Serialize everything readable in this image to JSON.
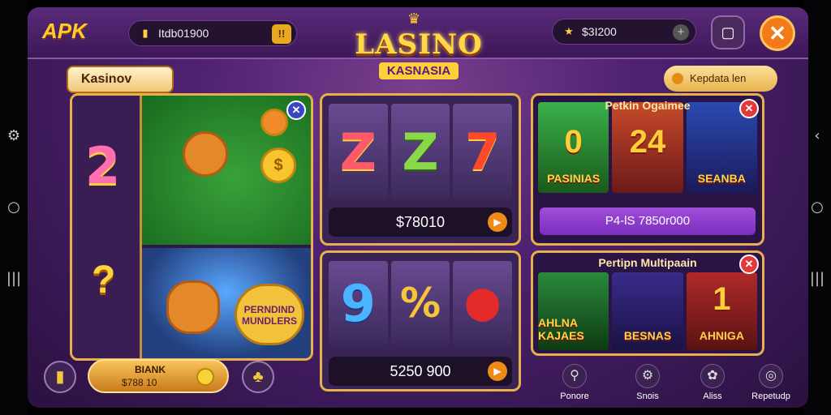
{
  "topbar": {
    "brand": "APK",
    "balance1": "Itdb01900",
    "balance2": "$3I200",
    "logo_line1": "LASINO",
    "logo_line2": "KASNASIA"
  },
  "tabs": {
    "left": "Kasinov",
    "right": "Kepdata len"
  },
  "left_panel": {
    "big_number": "2",
    "question": "?",
    "coin_symbol": "$",
    "badge_text": "PERNDIND MUNDLERS"
  },
  "slot1": {
    "reels": [
      "Z",
      "Z",
      "7"
    ],
    "amount": "$78010"
  },
  "slot2": {
    "reels": [
      "9",
      "%",
      "⬤"
    ],
    "amount": "5250 900"
  },
  "game_panel1": {
    "title": "Petkin Ogaimee",
    "tiles": [
      {
        "big": "0",
        "label": "PASINIAS"
      },
      {
        "big": "24",
        "label": ""
      },
      {
        "big": "",
        "label": "SEANBA"
      }
    ],
    "bar": "P4-lS 7850r000"
  },
  "game_panel2": {
    "title": "Pertipn Multipaain",
    "tiles": [
      {
        "big": "",
        "label": "AHLNA KAJAES"
      },
      {
        "big": "",
        "label": "BESNAS"
      },
      {
        "big": "1",
        "label": "AHNIGA"
      }
    ]
  },
  "bottom": {
    "bank_label": "BIANK",
    "bank_value": "$788 10",
    "nav": [
      {
        "icon": "person-icon",
        "label": "Ponore"
      },
      {
        "icon": "gear-icon",
        "label": "Snois"
      },
      {
        "icon": "gift-icon",
        "label": "Aliss"
      },
      {
        "icon": "chat-icon",
        "label": "Repetudp"
      }
    ]
  },
  "colors": {
    "accent_gold": "#e8b04c",
    "close_orange": "#f27a18",
    "purple_bar": "#8a3fcb"
  }
}
